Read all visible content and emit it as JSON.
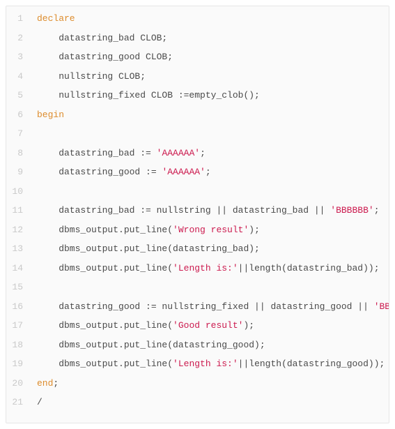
{
  "code": {
    "lines": [
      {
        "num": "1",
        "tokens": [
          {
            "t": "declare",
            "c": "keyword"
          }
        ]
      },
      {
        "num": "2",
        "tokens": [
          {
            "t": "    datastring_bad CLOB;",
            "c": "plain"
          }
        ]
      },
      {
        "num": "3",
        "tokens": [
          {
            "t": "    datastring_good CLOB;",
            "c": "plain"
          }
        ]
      },
      {
        "num": "4",
        "tokens": [
          {
            "t": "    nullstring CLOB;",
            "c": "plain"
          }
        ]
      },
      {
        "num": "5",
        "tokens": [
          {
            "t": "    nullstring_fixed CLOB :=empty_clob();",
            "c": "plain"
          }
        ]
      },
      {
        "num": "6",
        "tokens": [
          {
            "t": "begin",
            "c": "keyword"
          }
        ]
      },
      {
        "num": "7",
        "tokens": [
          {
            "t": " ",
            "c": "plain"
          }
        ]
      },
      {
        "num": "8",
        "tokens": [
          {
            "t": "    datastring_bad := ",
            "c": "plain"
          },
          {
            "t": "'AAAAAA'",
            "c": "string"
          },
          {
            "t": ";",
            "c": "plain"
          }
        ]
      },
      {
        "num": "9",
        "tokens": [
          {
            "t": "    datastring_good := ",
            "c": "plain"
          },
          {
            "t": "'AAAAAA'",
            "c": "string"
          },
          {
            "t": ";",
            "c": "plain"
          }
        ]
      },
      {
        "num": "10",
        "tokens": [
          {
            "t": " ",
            "c": "plain"
          }
        ]
      },
      {
        "num": "11",
        "tokens": [
          {
            "t": "    datastring_bad := nullstring || datastring_bad || ",
            "c": "plain"
          },
          {
            "t": "'BBBBBB'",
            "c": "string"
          },
          {
            "t": ";",
            "c": "plain"
          }
        ]
      },
      {
        "num": "12",
        "tokens": [
          {
            "t": "    dbms_output.put_line(",
            "c": "plain"
          },
          {
            "t": "'Wrong result'",
            "c": "string"
          },
          {
            "t": ");",
            "c": "plain"
          }
        ]
      },
      {
        "num": "13",
        "tokens": [
          {
            "t": "    dbms_output.put_line(datastring_bad);",
            "c": "plain"
          }
        ]
      },
      {
        "num": "14",
        "tokens": [
          {
            "t": "    dbms_output.put_line(",
            "c": "plain"
          },
          {
            "t": "'Length is:'",
            "c": "string"
          },
          {
            "t": "||length(datastring_bad));",
            "c": "plain"
          }
        ]
      },
      {
        "num": "15",
        "tokens": [
          {
            "t": " ",
            "c": "plain"
          }
        ]
      },
      {
        "num": "16",
        "tokens": [
          {
            "t": "    datastring_good := nullstring_fixed || datastring_good || ",
            "c": "plain"
          },
          {
            "t": "'BBBBBB'",
            "c": "string"
          },
          {
            "t": ";",
            "c": "plain"
          }
        ]
      },
      {
        "num": "17",
        "tokens": [
          {
            "t": "    dbms_output.put_line(",
            "c": "plain"
          },
          {
            "t": "'Good result'",
            "c": "string"
          },
          {
            "t": ");",
            "c": "plain"
          }
        ]
      },
      {
        "num": "18",
        "tokens": [
          {
            "t": "    dbms_output.put_line(datastring_good);",
            "c": "plain"
          }
        ]
      },
      {
        "num": "19",
        "tokens": [
          {
            "t": "    dbms_output.put_line(",
            "c": "plain"
          },
          {
            "t": "'Length is:'",
            "c": "string"
          },
          {
            "t": "||length(datastring_good));",
            "c": "plain"
          }
        ]
      },
      {
        "num": "20",
        "tokens": [
          {
            "t": "end",
            "c": "keyword"
          },
          {
            "t": ";",
            "c": "plain"
          }
        ]
      },
      {
        "num": "21",
        "tokens": [
          {
            "t": "/",
            "c": "plain"
          }
        ]
      }
    ]
  }
}
